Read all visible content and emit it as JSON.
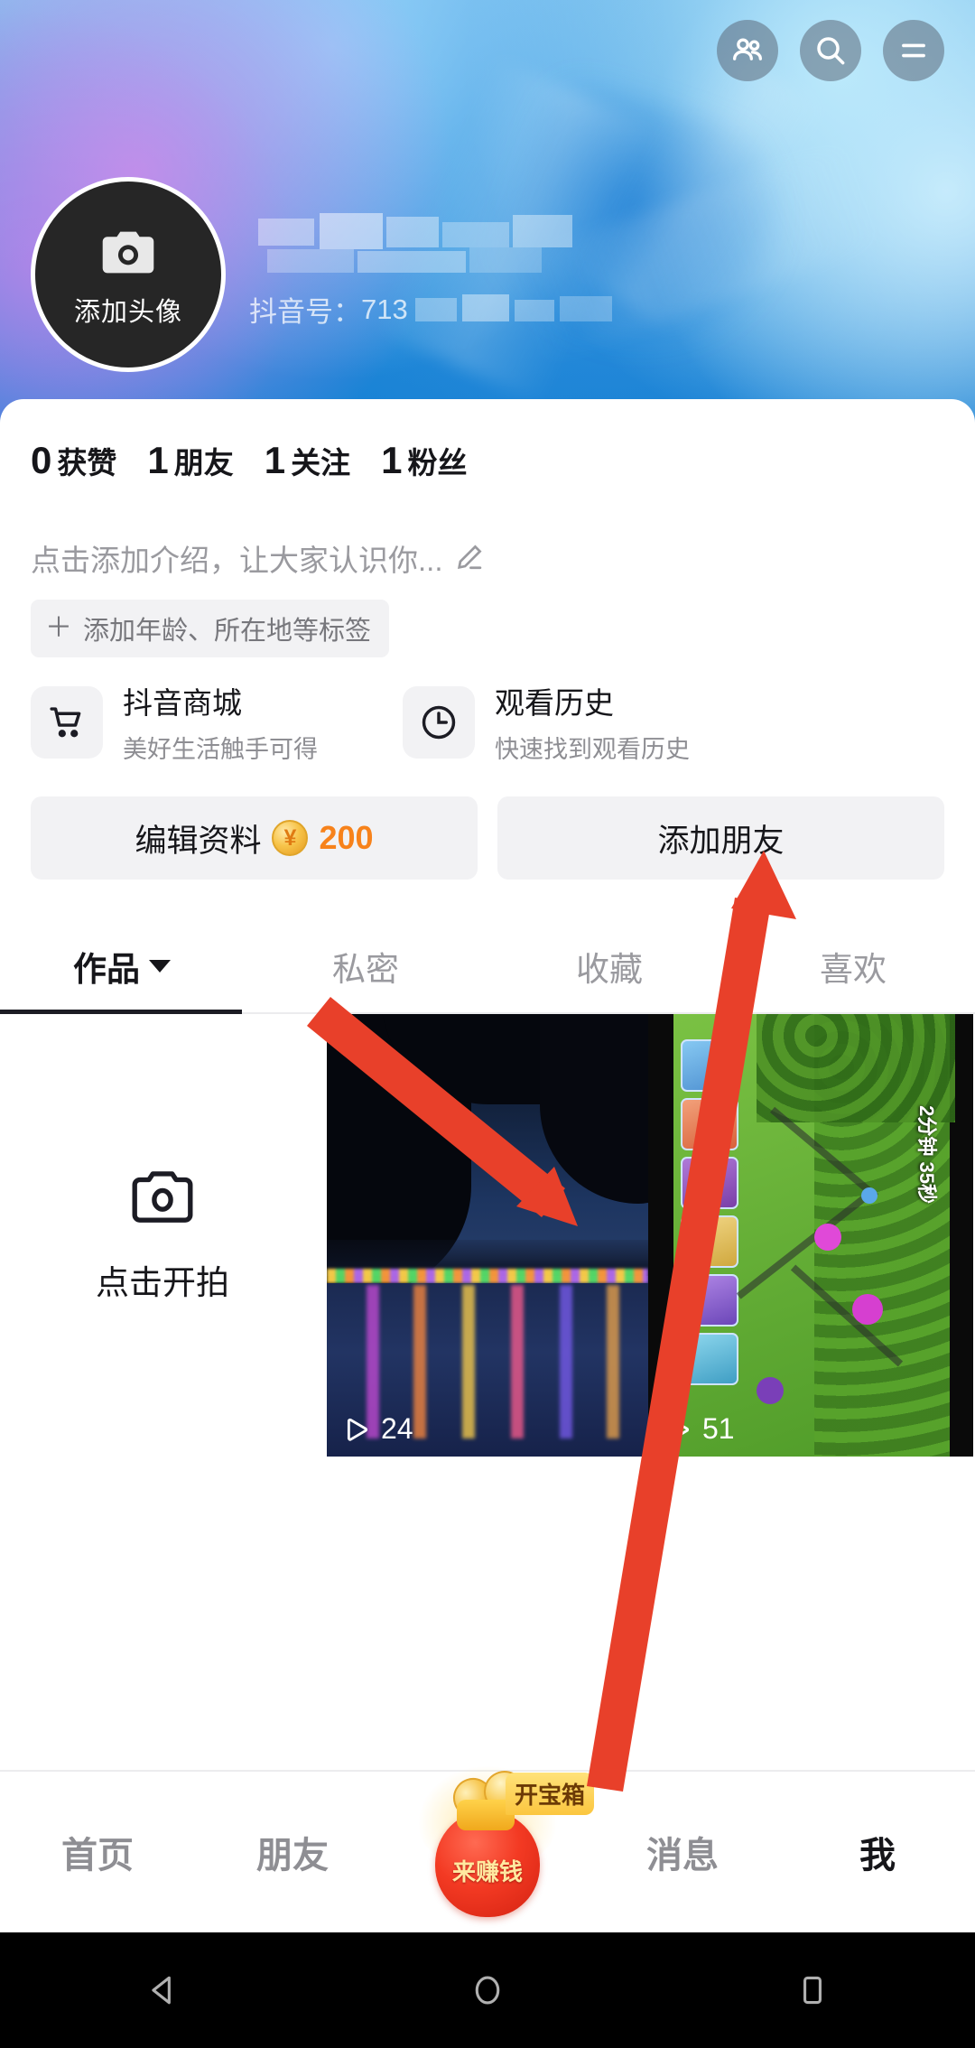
{
  "header": {
    "icons": [
      {
        "name": "friends-icon",
        "glyph": "people"
      },
      {
        "name": "search-icon",
        "glyph": "magnifier"
      },
      {
        "name": "menu-icon",
        "glyph": "hamburger"
      }
    ]
  },
  "profile": {
    "avatar_label": "添加头像",
    "avatar_icon": "camera-icon",
    "username_masked": "",
    "douyin_id_prefix": "抖音号：",
    "douyin_id_value": "713"
  },
  "stats": [
    {
      "num": "0",
      "label": "获赞"
    },
    {
      "num": "1",
      "label": "朋友"
    },
    {
      "num": "1",
      "label": "关注"
    },
    {
      "num": "1",
      "label": "粉丝"
    }
  ],
  "bio": {
    "text": "点击添加介绍，让大家认识你...",
    "edit_icon": "pencil-icon"
  },
  "tag_chip": {
    "plus": "＋",
    "label": "添加年龄、所在地等标签"
  },
  "shortcuts": [
    {
      "icon": "shopping-cart-icon",
      "title": "抖音商城",
      "subtitle": "美好生活触手可得"
    },
    {
      "icon": "clock-icon",
      "title": "观看历史",
      "subtitle": "快速找到观看历史"
    }
  ],
  "actions": {
    "edit_profile_label": "编辑资料",
    "coin_symbol": "¥",
    "coin_amount": "200",
    "add_friend_label": "添加朋友"
  },
  "tabs": [
    {
      "label": "作品",
      "active": true,
      "has_caret": true
    },
    {
      "label": "私密",
      "active": false,
      "has_caret": false
    },
    {
      "label": "收藏",
      "active": false,
      "has_caret": false
    },
    {
      "label": "喜欢",
      "active": false,
      "has_caret": false
    }
  ],
  "grid": {
    "shoot_label": "点击开拍",
    "shoot_icon": "camera-icon",
    "videos": [
      {
        "play_count": "24",
        "scene": "night-lake"
      },
      {
        "play_count": "51",
        "scene": "game-clash"
      }
    ]
  },
  "bottom_nav": [
    {
      "label": "首页",
      "active": false
    },
    {
      "label": "朋友",
      "active": false
    },
    {
      "label": "来赚钱",
      "badge": "开宝箱",
      "active": false,
      "is_earn": true
    },
    {
      "label": "消息",
      "active": false
    },
    {
      "label": "我",
      "active": true
    }
  ],
  "android_nav": [
    {
      "name": "back-button",
      "glyph": "triangle"
    },
    {
      "name": "home-button",
      "glyph": "circle"
    },
    {
      "name": "recents-button",
      "glyph": "square"
    }
  ],
  "annotations": {
    "arrow_color": "#e8402a",
    "arrows": [
      {
        "name": "arrow-to-video-thumb"
      },
      {
        "name": "arrow-to-like-tab"
      }
    ]
  }
}
